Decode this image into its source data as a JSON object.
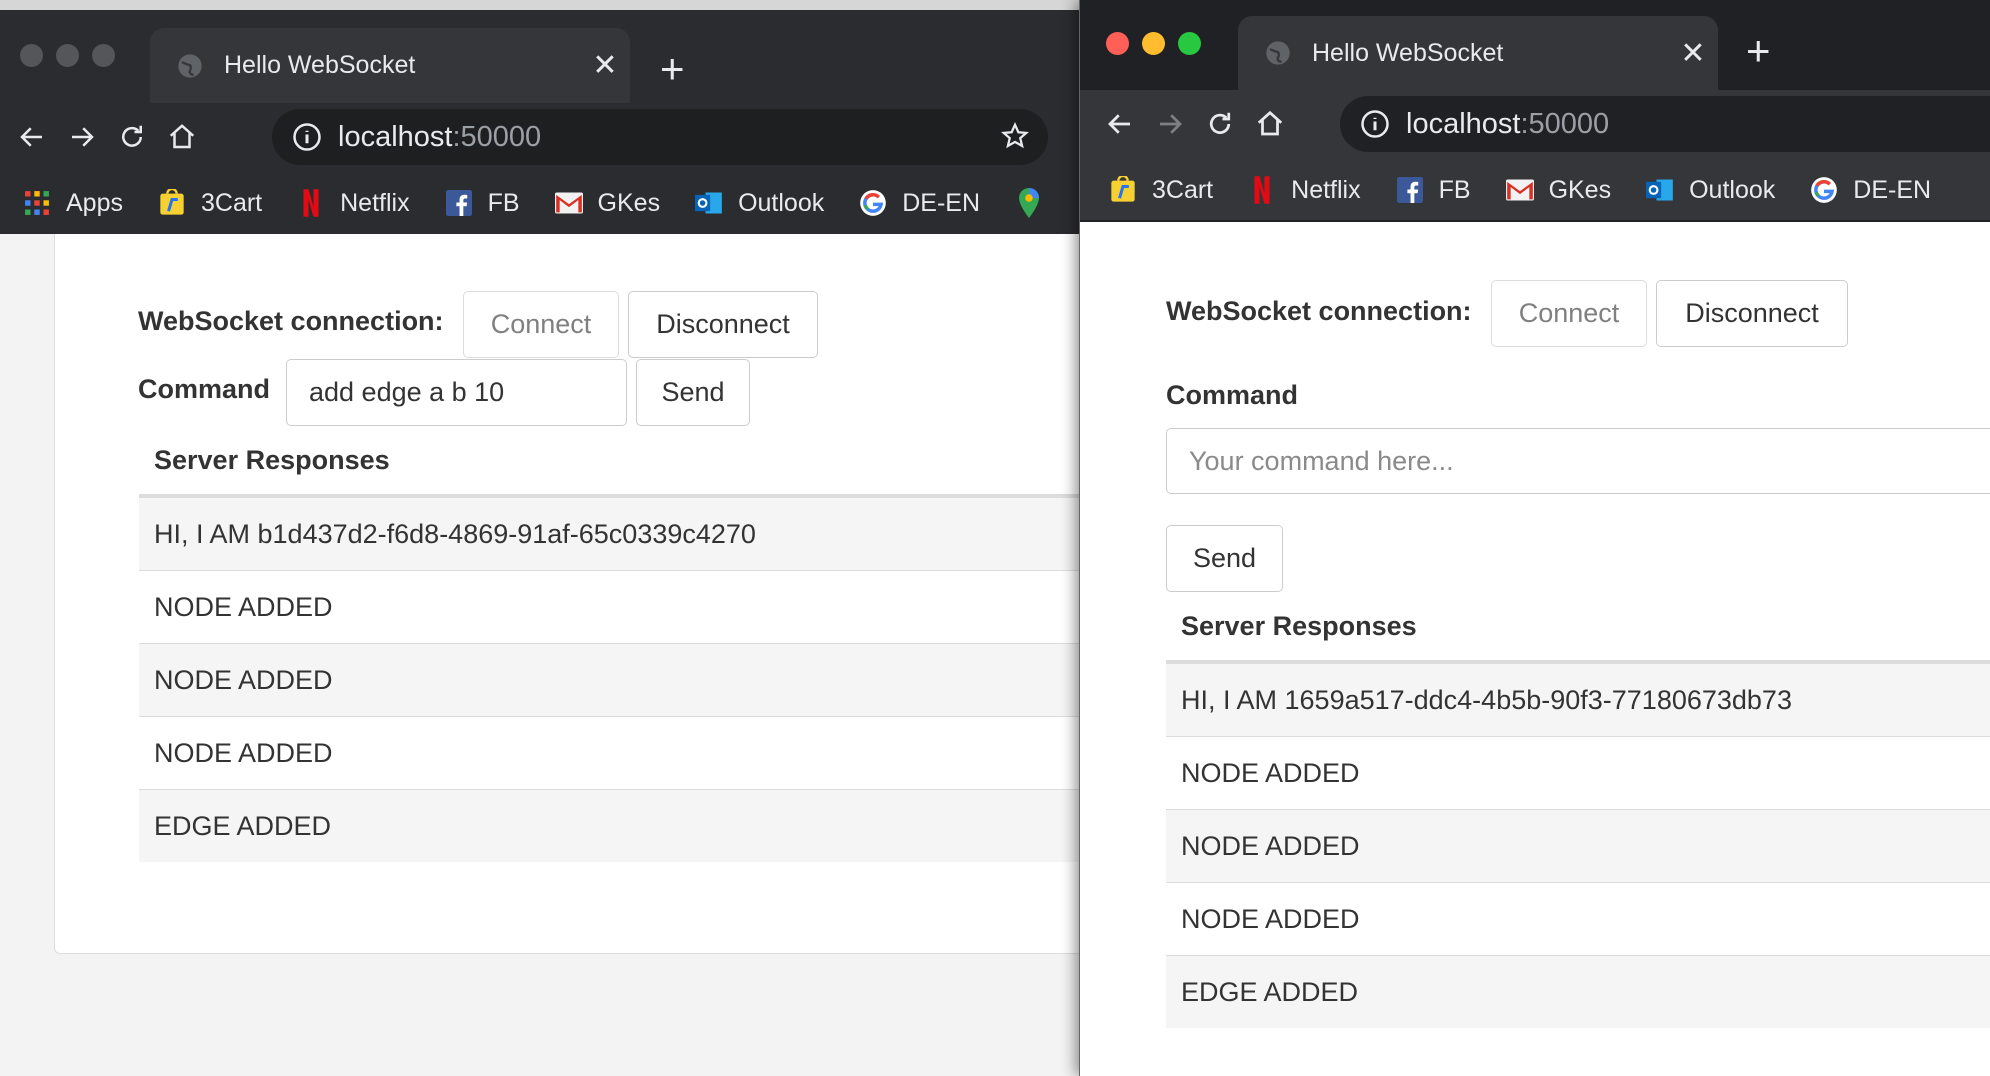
{
  "left_window": {
    "tab_title": "Hello WebSocket",
    "url_host": "localhost",
    "url_port": ":50000",
    "bookmarks": [
      {
        "label": "Apps",
        "icon": "apps-grid-icon"
      },
      {
        "label": "3Cart",
        "icon": "flipkart-icon"
      },
      {
        "label": "Netflix",
        "icon": "netflix-icon"
      },
      {
        "label": "FB",
        "icon": "facebook-icon"
      },
      {
        "label": "GKes",
        "icon": "gmail-icon"
      },
      {
        "label": "Outlook",
        "icon": "outlook-icon"
      },
      {
        "label": "DE-EN",
        "icon": "google-icon"
      }
    ],
    "page": {
      "connection_label": "WebSocket connection:",
      "connect_label": "Connect",
      "disconnect_label": "Disconnect",
      "command_label": "Command",
      "command_value": "add edge a b 10",
      "send_label": "Send",
      "responses_header": "Server Responses",
      "responses": [
        "HI, I AM b1d437d2-f6d8-4869-91af-65c0339c4270",
        "NODE ADDED",
        "NODE ADDED",
        "NODE ADDED",
        "EDGE ADDED"
      ]
    }
  },
  "right_window": {
    "tab_title": "Hello WebSocket",
    "url_host": "localhost",
    "url_port": ":50000",
    "bookmarks": [
      {
        "label": "3Cart",
        "icon": "flipkart-icon"
      },
      {
        "label": "Netflix",
        "icon": "netflix-icon"
      },
      {
        "label": "FB",
        "icon": "facebook-icon"
      },
      {
        "label": "GKes",
        "icon": "gmail-icon"
      },
      {
        "label": "Outlook",
        "icon": "outlook-icon"
      },
      {
        "label": "DE-EN",
        "icon": "google-icon"
      }
    ],
    "page": {
      "connection_label": "WebSocket connection:",
      "connect_label": "Connect",
      "disconnect_label": "Disconnect",
      "command_label": "Command",
      "command_placeholder": "Your command here...",
      "send_label": "Send",
      "responses_header": "Server Responses",
      "responses": [
        "HI, I AM 1659a517-ddc4-4b5b-90f3-77180673db73",
        "NODE ADDED",
        "NODE ADDED",
        "NODE ADDED",
        "EDGE ADDED"
      ]
    }
  },
  "colors": {
    "close_light": "#ff5f57",
    "minimize_light": "#febc2e",
    "zoom_light": "#28c840",
    "chrome_dark": "#202124",
    "text_dark": "#333333"
  }
}
